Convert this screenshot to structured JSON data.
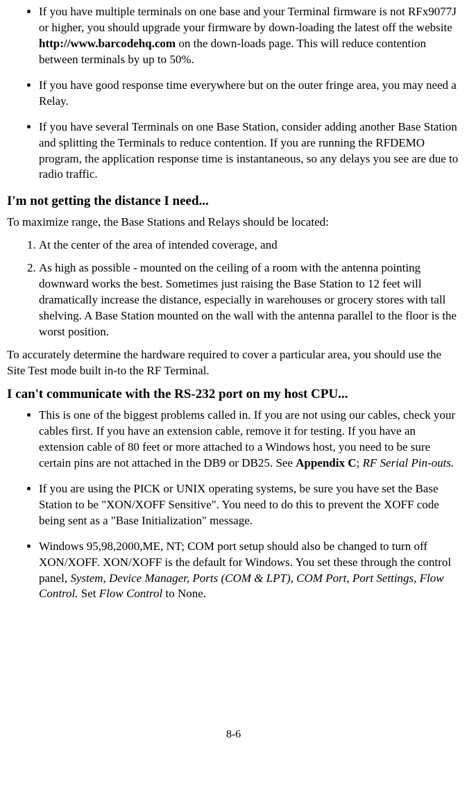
{
  "bullets1": {
    "item1_pre": "If you have multiple terminals on one base and your Terminal firmware is not RFx9077J or higher, you should upgrade your firmware by down-loading the latest off the website ",
    "item1_bold": "http://www.barcodehq.com",
    "item1_post": " on the down-loads page. This will reduce contention between terminals by up to 50%.",
    "item2": "If you have good response time everywhere but on the outer fringe area, you may need a Relay.",
    "item3": "If you have several Terminals on one Base Station, consider adding another Base Station and splitting the Terminals to reduce contention. If you are running the RFDEMO program, the application response time is instantaneous, so any delays you see are due to radio traffic."
  },
  "heading1": "I'm not getting the distance I need...",
  "para1": "To maximize range, the Base Stations and Relays should be located:",
  "numbers": {
    "n1": "At the center of the area of intended coverage, and",
    "n2": "As high as possible - mounted on the ceiling of a room with the antenna pointing downward works the best. Sometimes just raising the Base Station to 12 feet will dramatically increase the distance, especially in warehouses or grocery stores with tall shelving. A Base Station mounted on the wall with the antenna parallel to the floor is the worst position."
  },
  "para2": "To accurately determine the hardware required to cover a particular area, you should use the Site Test mode built in-to the RF Terminal.",
  "heading2": "I can't communicate with the RS-232 port on my host CPU...",
  "bullets2": {
    "item1_pre": "This is one of the biggest problems called in. If you are not using our cables, check your cables first. If you have an extension cable, remove it for testing. If you have an extension cable of 80 feet or more attached to a Windows host, you need to be sure certain pins are not attached in the DB9 or DB25. See ",
    "item1_bold": "Appendix C",
    "item1_mid": "; ",
    "item1_italic": "RF Serial Pin-outs.",
    "item2": "If you are using the PICK or UNIX operating systems, be sure you have set the Base Station to be \"XON/XOFF Sensitive\". You need to do this to prevent the XOFF code being sent as a \"Base Initialization\" message.",
    "item3_pre": "Windows 95,98,2000,ME, NT; COM port setup should also be changed to turn off XON/XOFF. XON/XOFF is the default for Windows. You set these through the control panel, ",
    "item3_italic1": "System, Device Manager, Ports (COM & LPT), COM Port, Port Settings, Flow Control.",
    "item3_mid": " Set ",
    "item3_italic2": "Flow Control",
    "item3_post": " to None."
  },
  "pageNumber": "8-6"
}
